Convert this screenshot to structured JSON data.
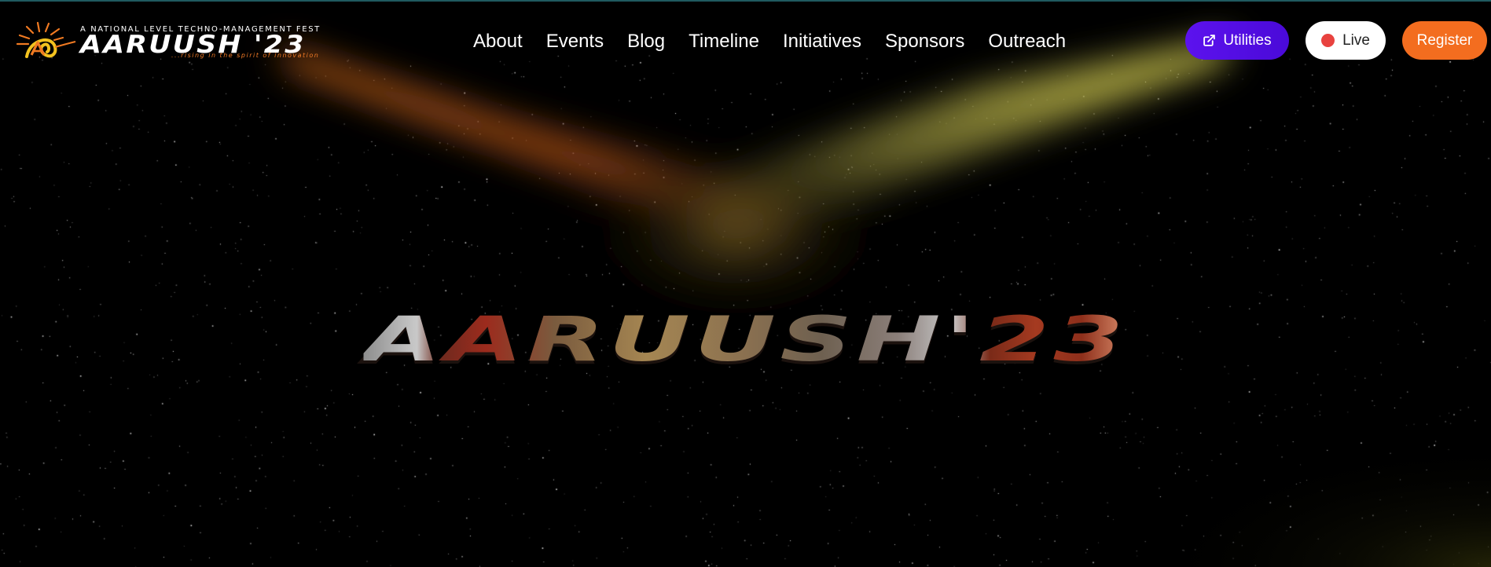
{
  "brand": {
    "tagline": "A NATIONAL LEVEL TECHNO-MANAGEMENT FEST",
    "name": "AARUUSH '23",
    "motto": "...rising in the spirit of innovation",
    "logo_icon": "sunburst-a-logo"
  },
  "nav": {
    "items": [
      {
        "label": "About"
      },
      {
        "label": "Events"
      },
      {
        "label": "Blog"
      },
      {
        "label": "Timeline"
      },
      {
        "label": "Initiatives"
      },
      {
        "label": "Sponsors"
      },
      {
        "label": "Outreach"
      }
    ]
  },
  "actions": {
    "utilities": {
      "label": "Utilities",
      "icon": "external-link-icon",
      "color": "#5c12ee"
    },
    "live": {
      "label": "Live",
      "icon": "live-dot-icon",
      "dot_color": "#e8423f"
    },
    "register": {
      "label": "Register",
      "color": "#f36d1f"
    }
  },
  "hero": {
    "title": "AARUUSH'23"
  },
  "theme": {
    "background": "#000000",
    "beam_left_color": "#e86a1a",
    "beam_right_color": "#d6cf45"
  }
}
